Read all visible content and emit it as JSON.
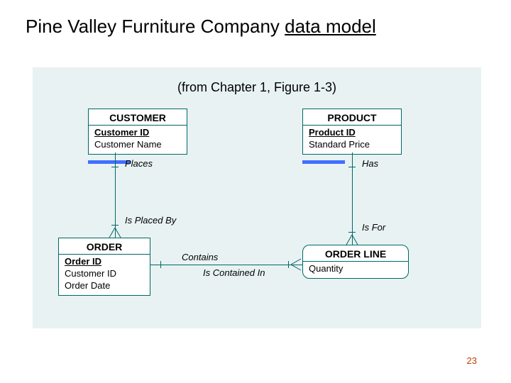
{
  "title": {
    "pre": "Pine Valley Furniture Company ",
    "emph": "data model"
  },
  "subtitle": "(from Chapter 1, Figure 1-3)",
  "page_number": "23",
  "entities": {
    "customer": {
      "name": "CUSTOMER",
      "key": "Customer ID",
      "attrs": [
        "Customer Name"
      ]
    },
    "product": {
      "name": "PRODUCT",
      "key": "Product ID",
      "attrs": [
        "Standard Price"
      ]
    },
    "order": {
      "name": "ORDER",
      "key": "Order ID",
      "attrs": [
        "Customer ID",
        "Order Date"
      ]
    },
    "order_line": {
      "name": "ORDER LINE",
      "key": "",
      "attrs": [
        "Quantity"
      ]
    }
  },
  "relationships": {
    "places": "Places",
    "is_placed_by": "Is Placed By",
    "has": "Has",
    "is_for": "Is For",
    "contains": "Contains",
    "is_contained_in": "Is Contained In"
  }
}
